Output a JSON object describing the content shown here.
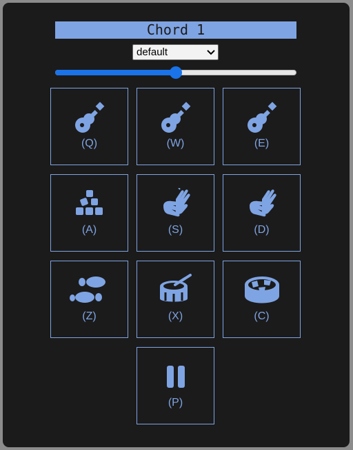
{
  "title": "Chord 1",
  "preset": {
    "selected": "default"
  },
  "volume": {
    "fraction": 0.5
  },
  "colors": {
    "accent": "#7fa4e3",
    "background": "#1b1b1b",
    "slider": "#1a73e8"
  },
  "pads": [
    {
      "key": "(Q)",
      "icon": "guitar-icon"
    },
    {
      "key": "(W)",
      "icon": "guitar-icon"
    },
    {
      "key": "(E)",
      "icon": "guitar-icon"
    },
    {
      "key": "(A)",
      "icon": "cubes-stacked-icon"
    },
    {
      "key": "(S)",
      "icon": "hands-clapping-icon"
    },
    {
      "key": "(D)",
      "icon": "hands-clapping-icon"
    },
    {
      "key": "(Z)",
      "icon": "shoe-prints-icon"
    },
    {
      "key": "(X)",
      "icon": "drum-icon"
    },
    {
      "key": "(C)",
      "icon": "drum-steelpan-icon"
    },
    {
      "key": "(P)",
      "icon": "pause-icon"
    }
  ]
}
